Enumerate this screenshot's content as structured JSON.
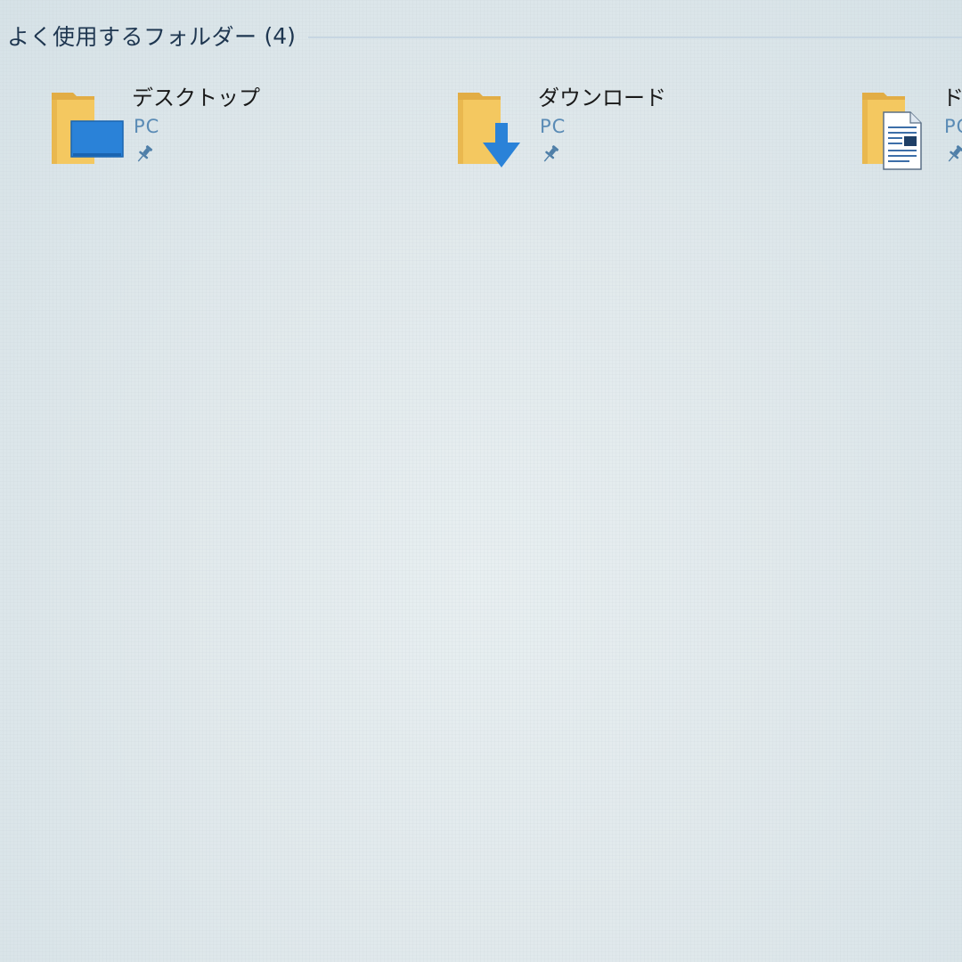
{
  "frequent_folders": {
    "title": "よく使用するフォルダー",
    "count": "(4)",
    "items": [
      {
        "name": "デスクトップ",
        "location": "PC",
        "icon": "desktop-folder-icon",
        "pinned": true
      },
      {
        "name": "ダウンロード",
        "location": "PC",
        "icon": "downloads-folder-icon",
        "pinned": true
      },
      {
        "name": "ド",
        "location": "PC",
        "icon": "documents-folder-icon",
        "pinned": true
      }
    ]
  },
  "colors": {
    "folder_yellow": "#f4c860",
    "accent_blue": "#1e88e5",
    "location_blue": "#5a8bb5"
  }
}
